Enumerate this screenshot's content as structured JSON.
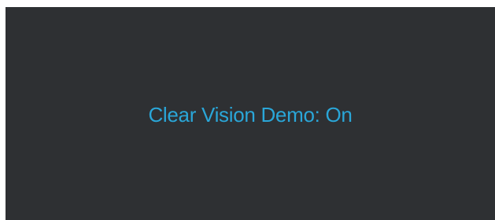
{
  "osd": {
    "message": "Clear Vision Demo: On"
  },
  "colors": {
    "background": "#2e3033",
    "text": "#2aa6d8"
  }
}
